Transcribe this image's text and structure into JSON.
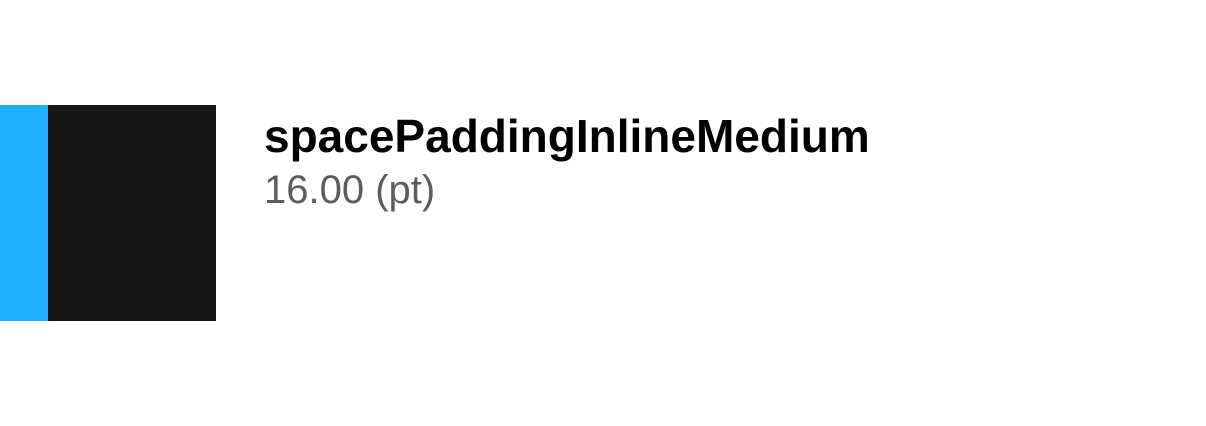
{
  "token": {
    "name": "spacePaddingInlineMedium",
    "value": "16.00 (pt)"
  },
  "colors": {
    "swatch": "#161616",
    "padding_indicator": "#1fb0ff",
    "name_text": "#000000",
    "value_text": "#5c5c5c"
  }
}
